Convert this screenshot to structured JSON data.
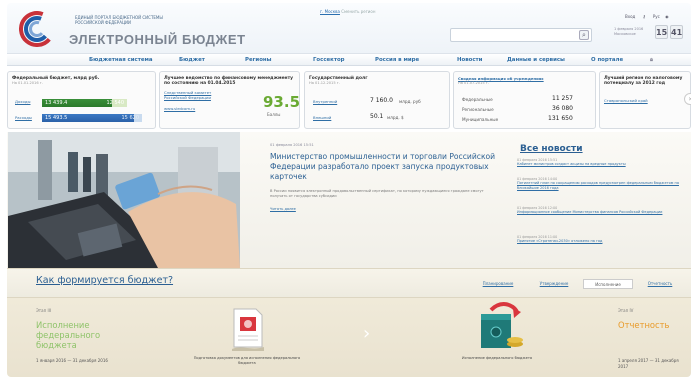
{
  "header": {
    "portal_line1": "ЕДИНЫЙ ПОРТАЛ БЮДЖЕТНОЙ СИСТЕМЫ",
    "portal_line2": "РОССИЙСКОЙ ФЕДЕРАЦИИ",
    "brand": "ЭЛЕКТРОННЫЙ БЮДЖЕТ",
    "city_label": "г. Москва",
    "city_change": "Сменить регион",
    "search_placeholder": "",
    "util_login": "Вход",
    "util_lang": "Рус",
    "date_line1": "1 февраля 2016",
    "date_line2": "Московское",
    "clock_h": "15",
    "clock_m": "41"
  },
  "nav": {
    "items": [
      "Бюджетная система",
      "Бюджет",
      "Регионы",
      "Госсектор",
      "Россия в мире",
      "Новости",
      "Данные и сервисы",
      "О портале"
    ]
  },
  "widgets": {
    "federal": {
      "title": "Федеральный бюджет, млрд руб.",
      "date": "На 01.01.2016 г.",
      "income_label": "Доходы",
      "income_value": "13 439.4",
      "income_plan": "12 540",
      "expense_label": "Расходы",
      "expense_value": "15 493.5",
      "expense_plan": "15 620",
      "income_fill": 0.82,
      "expense_fill": 0.92
    },
    "finmgmt": {
      "title": "Лучшее ведомство по финансовому менеджменту по состоянию на 01.04.2015",
      "link1": "Следственный комитет",
      "link2": "Российской Федерации",
      "link3": "www.sledcom.ru",
      "score": "93.5",
      "score_label": "Баллы"
    },
    "debt": {
      "title": "Государственный долг",
      "date": "На 01.12.2015 г.",
      "inner_label": "Внутренний",
      "inner_value": "7 160.0",
      "inner_unit": "млрд. руб",
      "outer_label": "Внешний",
      "outer_value": "50.1",
      "outer_unit": "млрд. $"
    },
    "institutions": {
      "title": "Сводная информация об учреждениях",
      "date": "На 01.07.2015 г.",
      "rows": [
        {
          "label": "Федеральные",
          "value": "11 257"
        },
        {
          "label": "Региональные",
          "value": "36 080"
        },
        {
          "label": "Муниципальные",
          "value": "131 650"
        }
      ]
    },
    "tax": {
      "title": "Лучший регион по налоговому потенциалу за 2012 год",
      "link": "Ставропольский край"
    }
  },
  "news_main": {
    "date": "01 февраля 2016 15:51",
    "headline": "Министерство промышленности и торговли Российской Федерации разработало проект запуска продуктовых карточек",
    "text": "В России появится электронный продовольственный сертификат, по которому нуждающиеся граждане смогут получать от государства субсидии",
    "more": "Читать далее"
  },
  "news_list": {
    "title": "Все новости",
    "items": [
      {
        "date": "01 февраля 2016 15:51",
        "title": "Кабинет министров создаст акцизы на вредные продукты"
      },
      {
        "date": "01 февраля 2016 14:00",
        "title": "Пятилетний план по сокращению расходов предусмотрен федеральным бюджетом на ближайшие 2016 года"
      },
      {
        "date": "01 февраля 2016 12:00",
        "title": "Информационное сообщение Министерства финансов Российской Федерации"
      },
      {
        "date": "01 февраля 2016 11:00",
        "title": "Принятие «Стратегии-2030» отложено на год"
      }
    ]
  },
  "how": {
    "title": "Как формируется бюджет?",
    "tabs": [
      "Планирование",
      "Утверждение",
      "Исполнение",
      "Отчетность"
    ]
  },
  "stages": {
    "left_label": "Этап III",
    "left_name": "Исполнение федерального бюджета",
    "left_date": "1 января 2016 — 31 декабря 2016",
    "doc_caption": "Подготовка документов для исполнения федерального бюджета",
    "exec_caption": "Исполнение федерального бюджета",
    "right_label": "Этап IV",
    "right_name": "Отчетность",
    "right_date": "1 апреля 2017 — 31 декабря 2017"
  }
}
